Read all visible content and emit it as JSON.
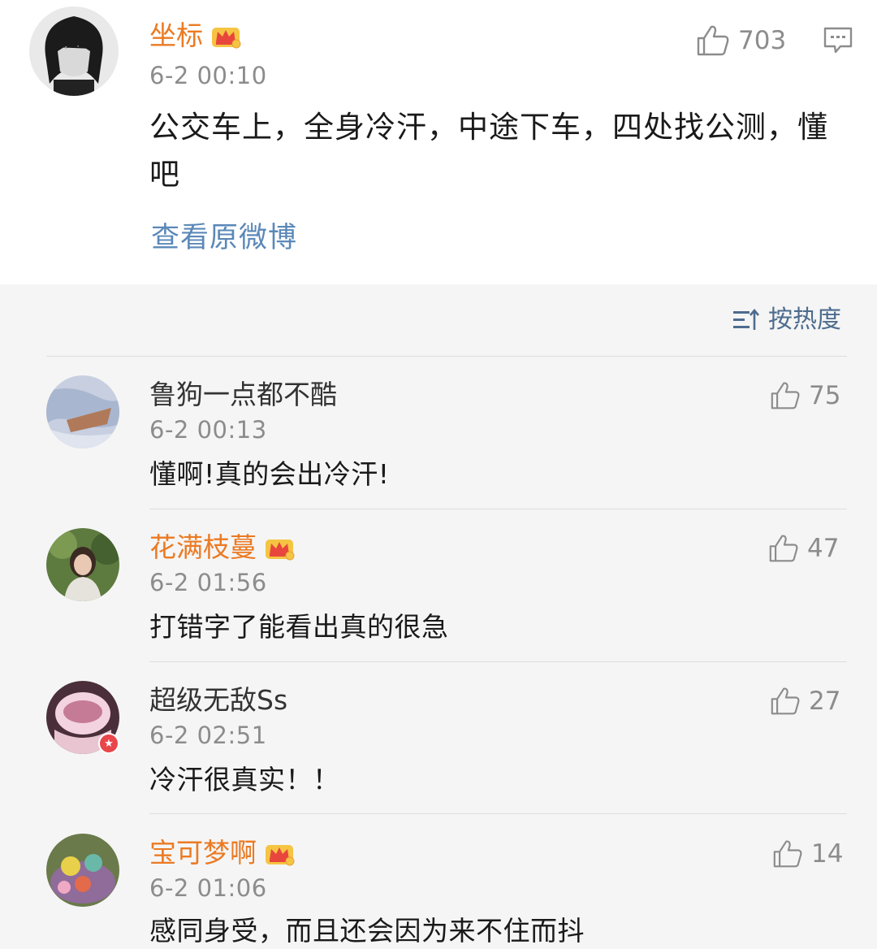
{
  "post": {
    "author": "坐标",
    "time": "6-2 00:10",
    "likes": "703",
    "text": "公交车上，全身冷汗，中途下车，四处找公测，懂吧",
    "link": "查看原微博"
  },
  "sort_label": "按热度",
  "comments": [
    {
      "author": "鲁狗一点都不酷",
      "time": "6-2 00:13",
      "likes": "75",
      "text": "懂啊!真的会出冷汗!"
    },
    {
      "author": "花满枝蔓",
      "time": "6-2 01:56",
      "likes": "47",
      "text": "打错字了能看出真的很急"
    },
    {
      "author": "超级无敌Ss",
      "time": "6-2 02:51",
      "likes": "27",
      "text": "冷汗很真实！！"
    },
    {
      "author": "宝可梦啊",
      "time": "6-2 01:06",
      "likes": "14",
      "text": "感同身受，而且还会因为来不住而抖"
    }
  ],
  "colors": {
    "vip_name": "#eb7a23",
    "link": "#5b88b8",
    "sort": "#4d6c8e",
    "meta_gray": "#8c8c8c"
  },
  "icons": [
    "thumbs-up-icon",
    "comment-icon",
    "sort-icon",
    "crown-badge-icon",
    "verified-badge-icon"
  ]
}
